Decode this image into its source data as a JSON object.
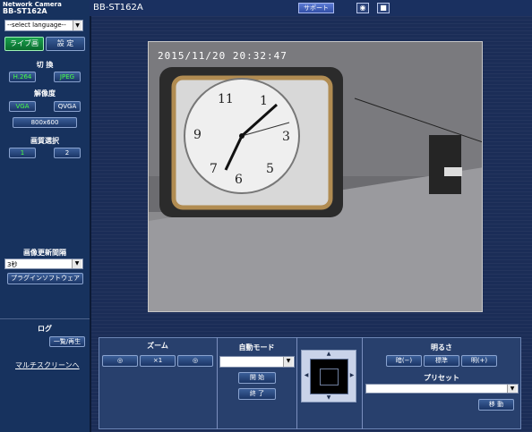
{
  "header": {
    "brand_small": "Network Camera",
    "brand_model": "BB-ST162A",
    "camera_title": "BB-ST162A",
    "help": "サポート"
  },
  "sidebar": {
    "language_select": "--select language--",
    "live_tab": "ライブ画",
    "settings_tab": "設 定",
    "switch_label": "切 換",
    "h264": "H.264",
    "jpeg": "JPEG",
    "resolution_label": "解像度",
    "vga": "VGA",
    "qvga": "QVGA",
    "size_640": "800x600",
    "quality_label": "画質選択",
    "quality1": "1",
    "quality2": "2",
    "refresh_label": "画像更新間隔",
    "refresh_value": "3秒",
    "plugin_btn": "プラグインソフトウェア",
    "log_label": "ログ",
    "log_btn": "一覧/再生",
    "multiscreen": "マルチスクリーンへ"
  },
  "video": {
    "timestamp": "2015/11/20  20:32:47"
  },
  "controls": {
    "zoom_title": "ズーム",
    "zoom_minus": "◎",
    "zoom_x1": "×1",
    "zoom_plus": "◎",
    "auto_title": "自動モード",
    "start": "開 始",
    "stop": "終 了",
    "brightness_title": "明るさ",
    "dark": "暗(−)",
    "standard": "標準",
    "bright": "明(+)",
    "preset_title": "プリセット",
    "move": "移 動"
  }
}
